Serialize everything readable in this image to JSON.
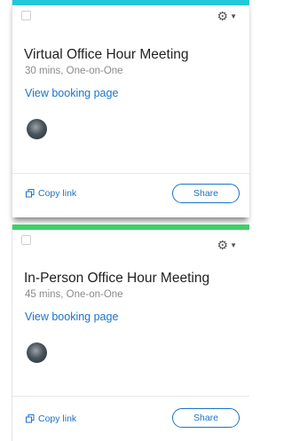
{
  "cards": [
    {
      "title": "Virtual Office Hour Meeting",
      "details": "30 mins, One-on-One",
      "view_link": "View booking page",
      "copy_link": "Copy link",
      "share": "Share",
      "accent_color": "#23c8d8",
      "gear_icon": "gear-icon"
    },
    {
      "title": "In-Person Office Hour Meeting",
      "details": "45 mins, One-on-One",
      "view_link": "View booking page",
      "copy_link": "Copy link",
      "share": "Share",
      "accent_color": "#3ecf6a",
      "gear_icon": "gear-icon"
    }
  ]
}
